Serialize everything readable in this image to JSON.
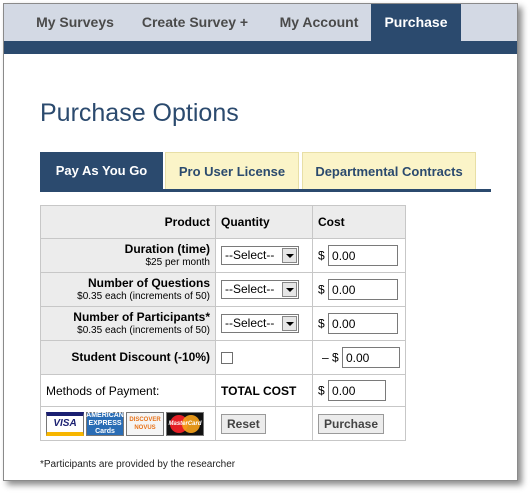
{
  "nav": {
    "tabs": [
      {
        "label": "My Surveys"
      },
      {
        "label": "Create Survey +"
      },
      {
        "label": "My Account"
      },
      {
        "label": "Purchase"
      }
    ],
    "active": "Purchase"
  },
  "page_title": "Purchase Options",
  "subtabs": [
    {
      "label": "Pay As You Go"
    },
    {
      "label": "Pro User License"
    },
    {
      "label": "Departmental Contracts"
    }
  ],
  "table": {
    "headers": {
      "product": "Product",
      "quantity": "Quantity",
      "cost": "Cost"
    },
    "rows": [
      {
        "label": "Duration (time)",
        "sub": "$25 per month",
        "select": "--Select--",
        "currency": "$",
        "cost": "0.00"
      },
      {
        "label": "Number of Questions",
        "sub": "$0.35 each (increments of 50)",
        "select": "--Select--",
        "currency": "$",
        "cost": "0.00"
      },
      {
        "label": "Number of Participants*",
        "sub": "$0.35 each (increments of 50)",
        "select": "--Select--",
        "currency": "$",
        "cost": "0.00"
      }
    ],
    "discount": {
      "label": "Student Discount (-10%)",
      "prefix": "– $",
      "cost": "0.00"
    },
    "payment": {
      "label": "Methods of Payment:",
      "total_label": "TOTAL COST",
      "currency": "$",
      "total": "0.00"
    },
    "cards": {
      "visa": "VISA",
      "amex": "AMERICAN EXPRESS Cards",
      "discover": "DISCOVER NOVUS",
      "mastercard": "MasterCard"
    },
    "reset_label": "Reset",
    "purchase_label": "Purchase"
  },
  "footnote": "*Participants are provided by the researcher",
  "colors": {
    "primary": "#2b4a6e",
    "nav_bg": "#d3d9e4",
    "tab_inactive": "#fbf4c8"
  }
}
